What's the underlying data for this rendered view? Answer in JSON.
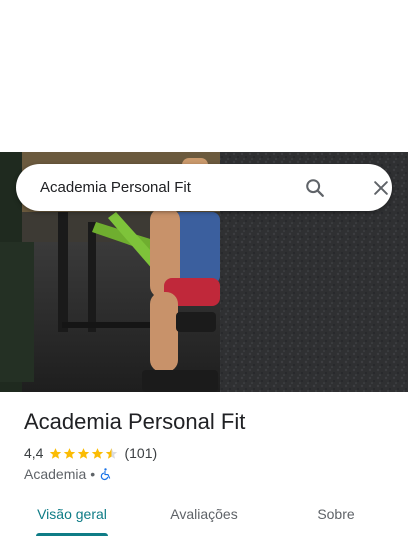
{
  "search": {
    "query": "Academia Personal Fit"
  },
  "icons": {
    "search": "search-icon",
    "close": "close-icon",
    "star": "star-icon",
    "accessibility": "wheelchair-icon"
  },
  "place": {
    "name": "Academia Personal Fit",
    "rating": "4,4",
    "rating_fraction": 0.88,
    "reviews": "(101)",
    "category": "Academia",
    "separator": "•"
  },
  "tabs": [
    {
      "label": "Visão geral",
      "active": true
    },
    {
      "label": "Avaliações",
      "active": false
    },
    {
      "label": "Sobre",
      "active": false
    }
  ],
  "colors": {
    "accent": "#0e7c86",
    "star": "#fbbc04",
    "accessibility_icon": "#1a73e8"
  }
}
